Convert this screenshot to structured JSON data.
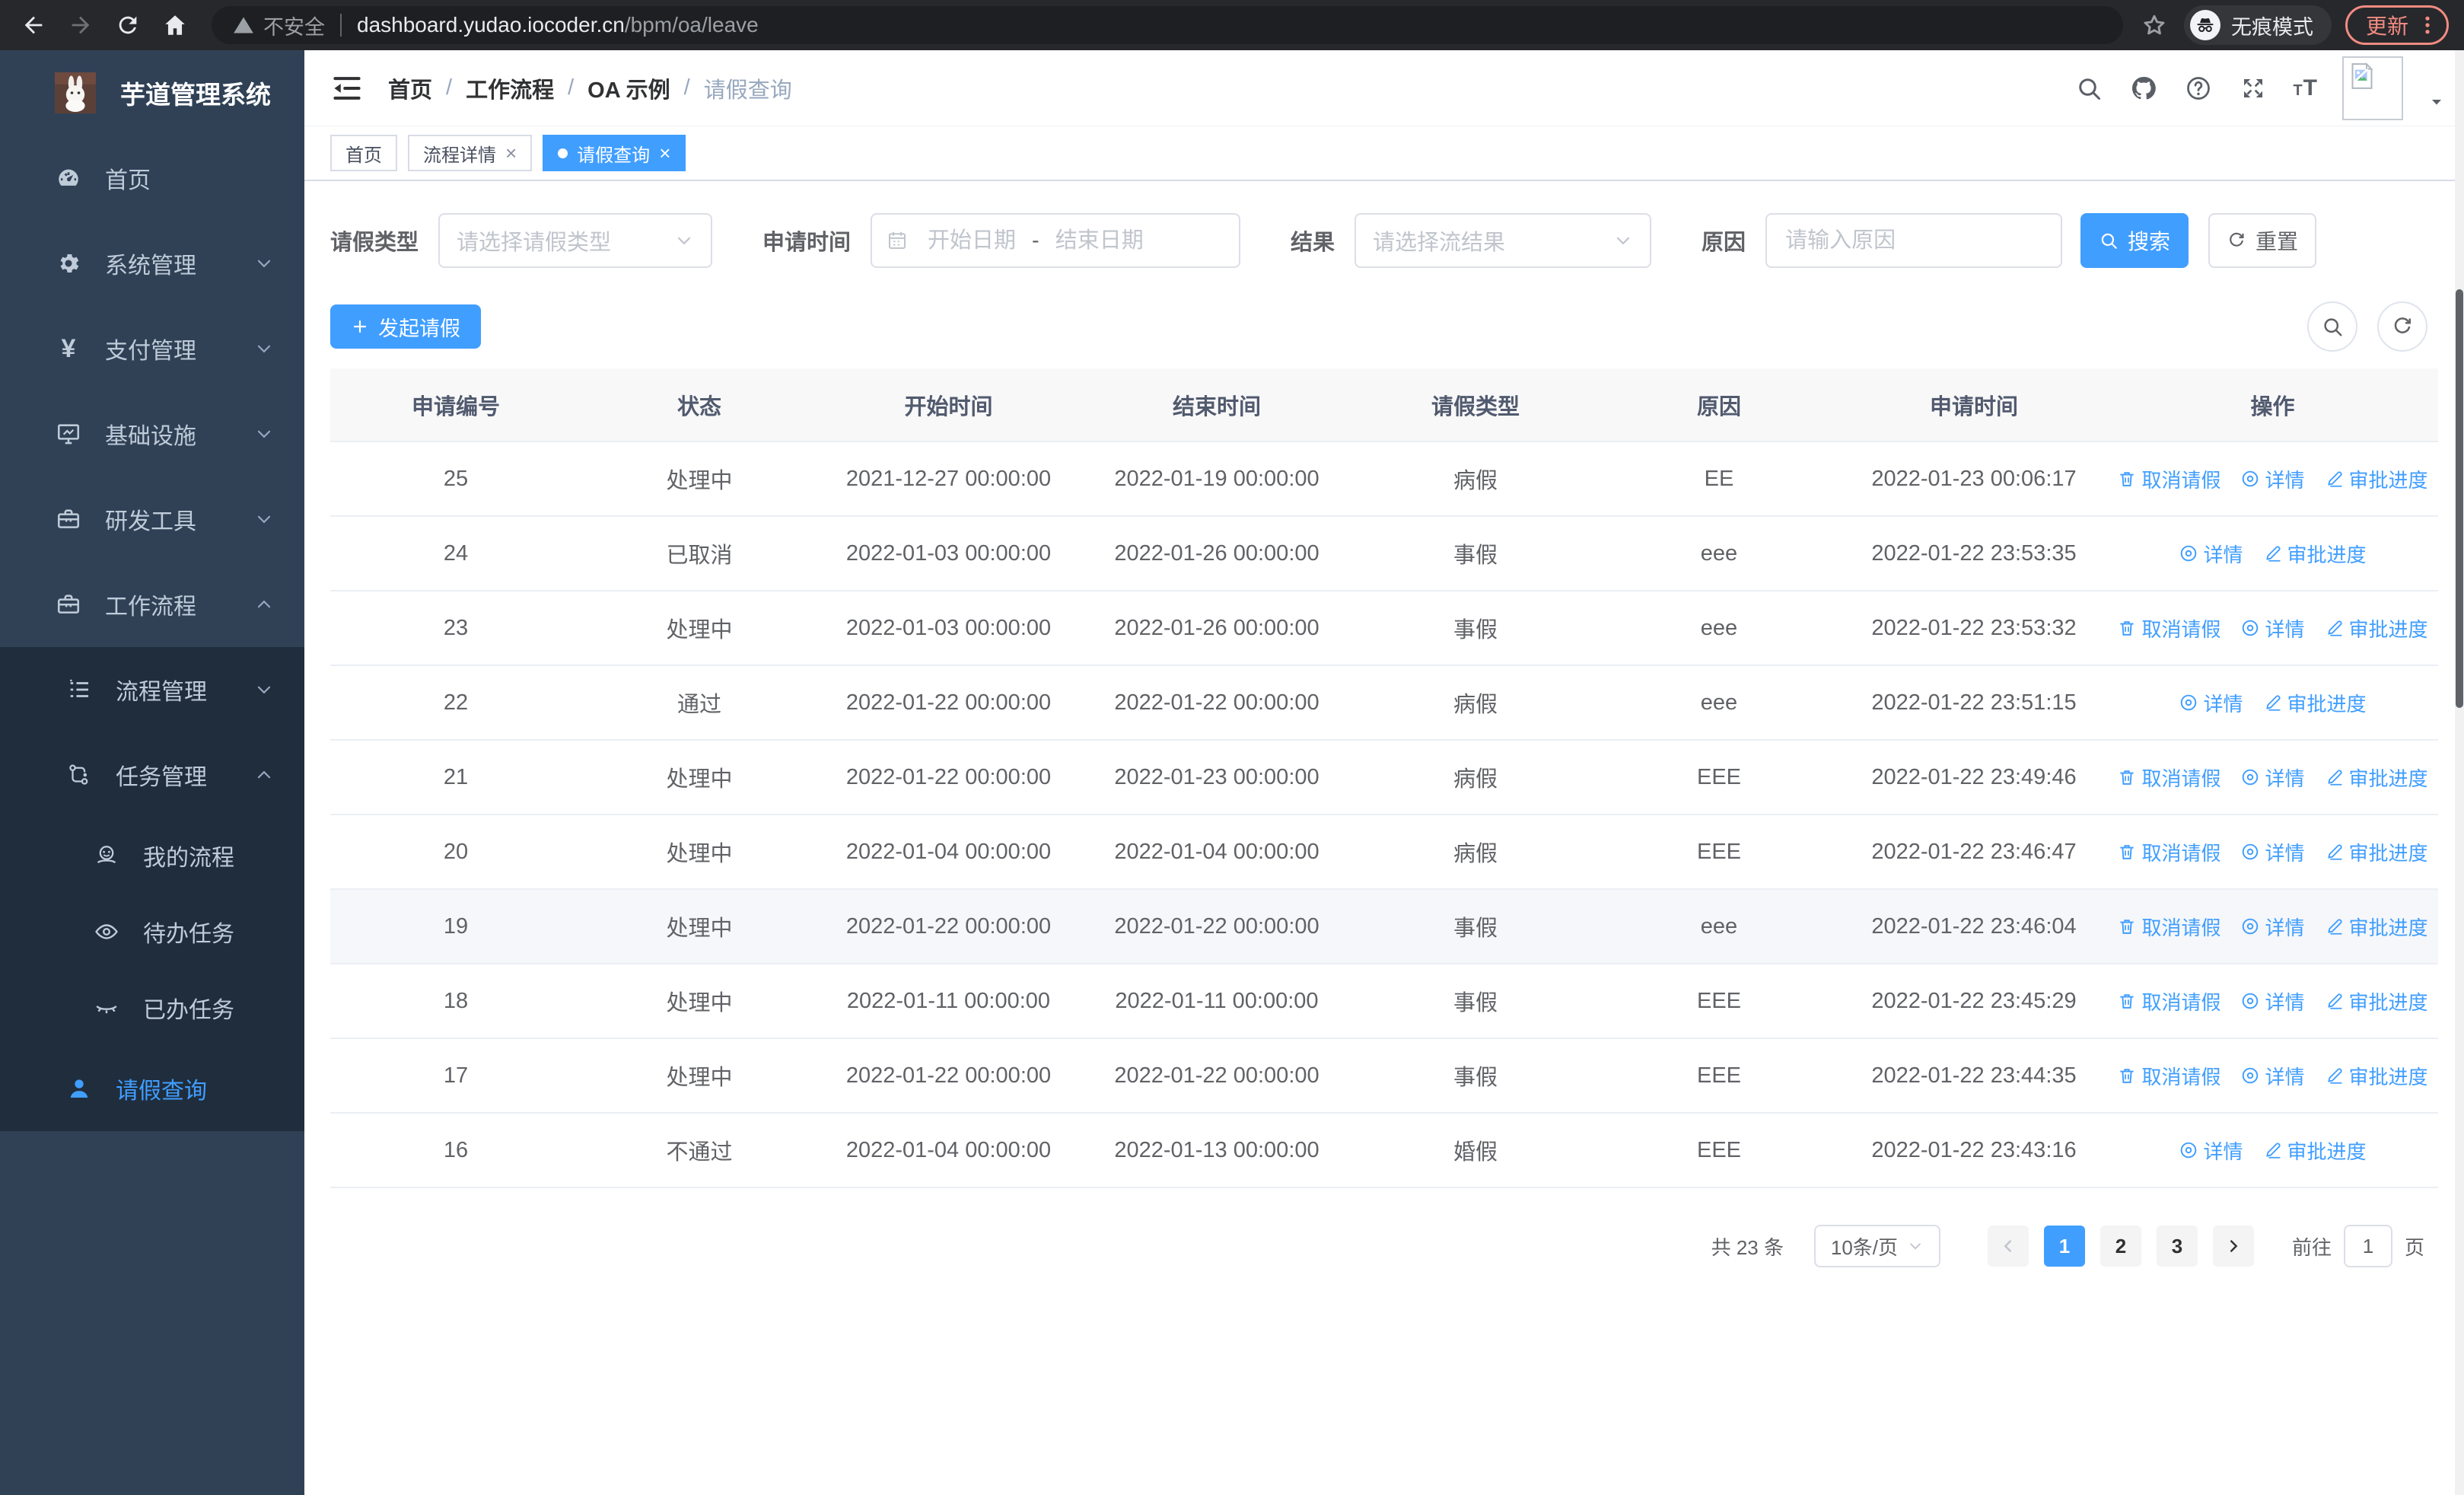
{
  "browser": {
    "security_warning": "不安全",
    "url_domain": "dashboard.yudao.iocoder.cn",
    "url_path": "/bpm/oa/leave",
    "incognito_label": "无痕模式",
    "update_label": "更新"
  },
  "sidebar": {
    "brand": "芋道管理系统",
    "menu": [
      {
        "label": "首页"
      },
      {
        "label": "系统管理"
      },
      {
        "label": "支付管理"
      },
      {
        "label": "基础设施"
      },
      {
        "label": "研发工具"
      },
      {
        "label": "工作流程"
      }
    ],
    "submenu": [
      {
        "label": "流程管理"
      },
      {
        "label": "任务管理"
      },
      {
        "label": "我的流程"
      },
      {
        "label": "待办任务"
      },
      {
        "label": "已办任务"
      },
      {
        "label": "请假查询"
      }
    ]
  },
  "header": {
    "breadcrumb": [
      "首页",
      "工作流程",
      "OA 示例",
      "请假查询"
    ],
    "font_icon_small": "T",
    "font_icon_large": "T"
  },
  "tabs": [
    {
      "label": "首页"
    },
    {
      "label": "流程详情"
    },
    {
      "label": "请假查询"
    }
  ],
  "filters": {
    "leave_type_label": "请假类型",
    "leave_type_placeholder": "请选择请假类型",
    "apply_time_label": "申请时间",
    "start_date_placeholder": "开始日期",
    "range_separator": "-",
    "end_date_placeholder": "结束日期",
    "result_label": "结果",
    "result_placeholder": "请选择流结果",
    "reason_label": "原因",
    "reason_placeholder": "请输入原因",
    "search_label": "搜索",
    "reset_label": "重置"
  },
  "toolbar": {
    "create_label": "发起请假"
  },
  "table": {
    "columns": [
      "申请编号",
      "状态",
      "开始时间",
      "结束时间",
      "请假类型",
      "原因",
      "申请时间",
      "操作"
    ],
    "action_labels": {
      "cancel": "取消请假",
      "detail": "详情",
      "progress": "审批进度"
    },
    "action_icons": {
      "cancel": "i-trash",
      "detail": "i-view",
      "progress": "i-pen"
    },
    "rows": [
      {
        "id": "25",
        "status": "处理中",
        "start": "2021-12-27 00:00:00",
        "end": "2022-01-19 00:00:00",
        "type": "病假",
        "reason": "EE",
        "applied": "2022-01-23 00:06:17",
        "actions": [
          "cancel",
          "detail",
          "progress"
        ],
        "highlight": false
      },
      {
        "id": "24",
        "status": "已取消",
        "start": "2022-01-03 00:00:00",
        "end": "2022-01-26 00:00:00",
        "type": "事假",
        "reason": "eee",
        "applied": "2022-01-22 23:53:35",
        "actions": [
          "detail",
          "progress"
        ],
        "highlight": false
      },
      {
        "id": "23",
        "status": "处理中",
        "start": "2022-01-03 00:00:00",
        "end": "2022-01-26 00:00:00",
        "type": "事假",
        "reason": "eee",
        "applied": "2022-01-22 23:53:32",
        "actions": [
          "cancel",
          "detail",
          "progress"
        ],
        "highlight": false
      },
      {
        "id": "22",
        "status": "通过",
        "start": "2022-01-22 00:00:00",
        "end": "2022-01-22 00:00:00",
        "type": "病假",
        "reason": "eee",
        "applied": "2022-01-22 23:51:15",
        "actions": [
          "detail",
          "progress"
        ],
        "highlight": false
      },
      {
        "id": "21",
        "status": "处理中",
        "start": "2022-01-22 00:00:00",
        "end": "2022-01-23 00:00:00",
        "type": "病假",
        "reason": "EEE",
        "applied": "2022-01-22 23:49:46",
        "actions": [
          "cancel",
          "detail",
          "progress"
        ],
        "highlight": false
      },
      {
        "id": "20",
        "status": "处理中",
        "start": "2022-01-04 00:00:00",
        "end": "2022-01-04 00:00:00",
        "type": "病假",
        "reason": "EEE",
        "applied": "2022-01-22 23:46:47",
        "actions": [
          "cancel",
          "detail",
          "progress"
        ],
        "highlight": false
      },
      {
        "id": "19",
        "status": "处理中",
        "start": "2022-01-22 00:00:00",
        "end": "2022-01-22 00:00:00",
        "type": "事假",
        "reason": "eee",
        "applied": "2022-01-22 23:46:04",
        "actions": [
          "cancel",
          "detail",
          "progress"
        ],
        "highlight": true
      },
      {
        "id": "18",
        "status": "处理中",
        "start": "2022-01-11 00:00:00",
        "end": "2022-01-11 00:00:00",
        "type": "事假",
        "reason": "EEE",
        "applied": "2022-01-22 23:45:29",
        "actions": [
          "cancel",
          "detail",
          "progress"
        ],
        "highlight": false
      },
      {
        "id": "17",
        "status": "处理中",
        "start": "2022-01-22 00:00:00",
        "end": "2022-01-22 00:00:00",
        "type": "事假",
        "reason": "EEE",
        "applied": "2022-01-22 23:44:35",
        "actions": [
          "cancel",
          "detail",
          "progress"
        ],
        "highlight": false
      },
      {
        "id": "16",
        "status": "不通过",
        "start": "2022-01-04 00:00:00",
        "end": "2022-01-13 00:00:00",
        "type": "婚假",
        "reason": "EEE",
        "applied": "2022-01-22 23:43:16",
        "actions": [
          "detail",
          "progress"
        ],
        "highlight": false
      }
    ]
  },
  "pagination": {
    "total": "共 23 条",
    "size": "10条/页",
    "pages": [
      "1",
      "2",
      "3"
    ],
    "active_page": "1",
    "goto_label": "前往",
    "goto_value": "1",
    "unit": "页"
  },
  "colors": {
    "accent": "#409eff",
    "sidebar_bg": "#304156",
    "submenu_bg": "#1f2d3d",
    "active_tag_bg": "#409eff",
    "update_chip": "#f28b82"
  }
}
